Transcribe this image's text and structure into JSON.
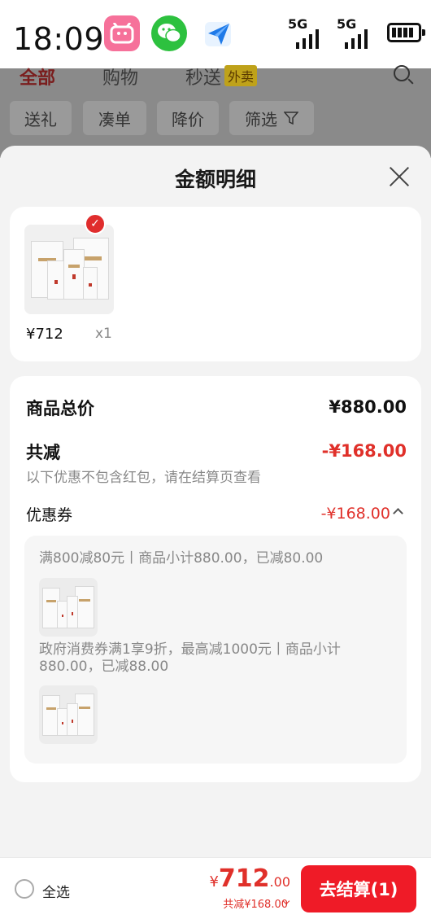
{
  "status_bar": {
    "time": "18:09",
    "signal_1_label": "5G",
    "signal_2_label": "5G",
    "apps": [
      "bilibili-icon",
      "wechat-icon",
      "send-icon"
    ]
  },
  "background": {
    "tabs": [
      "全部",
      "购物",
      "秒送"
    ],
    "tab_badge": "外卖",
    "chips": [
      "送礼",
      "凑单",
      "降价",
      "筛选"
    ]
  },
  "sheet": {
    "title": "金额明细",
    "item": {
      "price": "¥712",
      "qty": "x1"
    },
    "summary": {
      "total_label": "商品总价",
      "total_value": "¥880.00",
      "reduction_label": "共减",
      "reduction_value": "-¥168.00",
      "note": "以下优惠不包含红包，请在结算页查看",
      "coupon_label": "优惠券",
      "coupon_value": "-¥168.00"
    },
    "coupons": [
      {
        "text": "满800减80元丨商品小计880.00，已减80.00"
      },
      {
        "text": "政府消费券满1享9折，最高减1000元丨商品小计880.00，已减88.00"
      }
    ]
  },
  "bottom_bar": {
    "select_all_label": "全选",
    "currency": "¥",
    "total_int": "712",
    "total_dec": ".00",
    "saved_text": "共减¥168.00",
    "checkout_label": "去结算(1)"
  },
  "colors": {
    "accent_red": "#ef1b27",
    "price_red": "#e0302a"
  }
}
